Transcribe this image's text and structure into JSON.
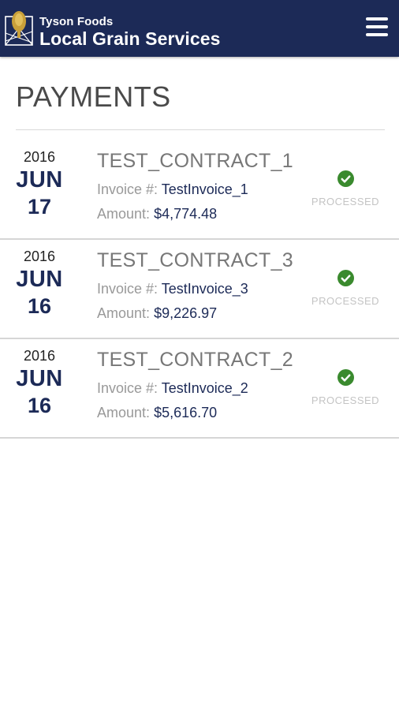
{
  "header": {
    "brand_top": "Tyson Foods",
    "brand_main": "Local Grain Services",
    "background_color": "#1c2a57",
    "menu_icon": "hamburger-menu-icon"
  },
  "page": {
    "title": "PAYMENTS"
  },
  "labels": {
    "invoice": "Invoice #:",
    "amount": "Amount:"
  },
  "payments": [
    {
      "year": "2016",
      "month": "JUN",
      "day": "17",
      "contract": "TEST_CONTRACT_1",
      "invoice": "TestInvoice_1",
      "amount": "$4,774.48",
      "status": "PROCESSED"
    },
    {
      "year": "2016",
      "month": "JUN",
      "day": "16",
      "contract": "TEST_CONTRACT_3",
      "invoice": "TestInvoice_3",
      "amount": "$9,226.97",
      "status": "PROCESSED"
    },
    {
      "year": "2016",
      "month": "JUN",
      "day": "16",
      "contract": "TEST_CONTRACT_2",
      "invoice": "TestInvoice_2",
      "amount": "$5,616.70",
      "status": "PROCESSED"
    }
  ],
  "colors": {
    "accent": "#1c2a57",
    "status_ok": "#3a8a2e"
  }
}
